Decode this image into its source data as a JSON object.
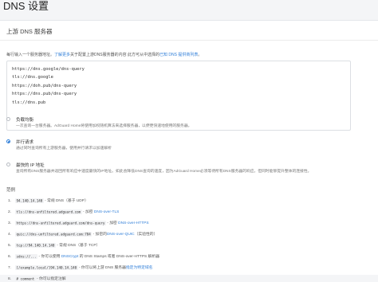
{
  "page": {
    "title": "DNS 设置"
  },
  "upstream": {
    "header": "上游 DNS 服务器",
    "desc_prefix": "每行输入一个服务器地址。",
    "desc_link1": "了解更多",
    "desc_middle": "关于配置上游DNS服务器的内容 此方可从中选择的",
    "desc_link2": "已知 DNS 提供商列表",
    "desc_suffix": "。",
    "servers": [
      "https://dns.google/dns-query",
      "tls://dns.google",
      "https://doh.pub/dns-query",
      "https://dns.pub/dns-query",
      "tls://dns.pub"
    ]
  },
  "mode_options": [
    {
      "title": "负载均衡",
      "desc": "一次查询一台服务器。AdGuard Home将使用加权随机算法来选择服务器，以便更快速地使用的服务器。",
      "checked": false
    },
    {
      "title": "并行请求",
      "desc": "通过同时查询所有上游服务器，使用并行请求以加速解析",
      "checked": true
    },
    {
      "title": "最快的 IP 地址",
      "desc": "查询所有DNS服务器并返回所有响应中速度最快的IP地址。如此会降低DNS查询的速度，因为AdGuard Home必须等待所有DNS服务器的响应，但同时能够提升整体的连接性。",
      "checked": false
    }
  ],
  "examples": {
    "title": "范例",
    "items": [
      {
        "num": "1.",
        "code": "94.140.14.140",
        "text": " - 常规 DNS（基于 UDP）",
        "link": "",
        "rest": ""
      },
      {
        "num": "2.",
        "code": "tls://dns-unfiltered.adguard.com",
        "text": " - 加密 ",
        "link": "DNS-over-TLS",
        "rest": ""
      },
      {
        "num": "3.",
        "code": "https://dns-unfiltered.adguard.com/dns-query",
        "text": " - 加密 ",
        "link": "DNS-over-HTTPS",
        "rest": ""
      },
      {
        "num": "4.",
        "code": "quic://dns-unfiltered.adguard.com:784",
        "text": " - 加密的",
        "link": "DNS-over-QUIC",
        "rest": "（实验性的）"
      },
      {
        "num": "5.",
        "code": "tcp://94.140.14.140",
        "text": " - 常规 DNS（基于 TCP）",
        "link": "",
        "rest": ""
      },
      {
        "num": "6.",
        "code": "sdns://...",
        "text": " - 你可以使用 ",
        "link": "DNSCrypt",
        "rest": " 的 DNS Stamps 或者 DNS-over-HTTPS 解析器"
      },
      {
        "num": "7.",
        "code": "[/example.local/]94.140.14.140",
        "text": " - 你可以将上游 DNS 服务器",
        "link": "指定为特定域名",
        "rest": ""
      },
      {
        "num": "8.",
        "code": "# comment",
        "text": " - 你可以指定注解",
        "link": "",
        "rest": ""
      }
    ]
  }
}
